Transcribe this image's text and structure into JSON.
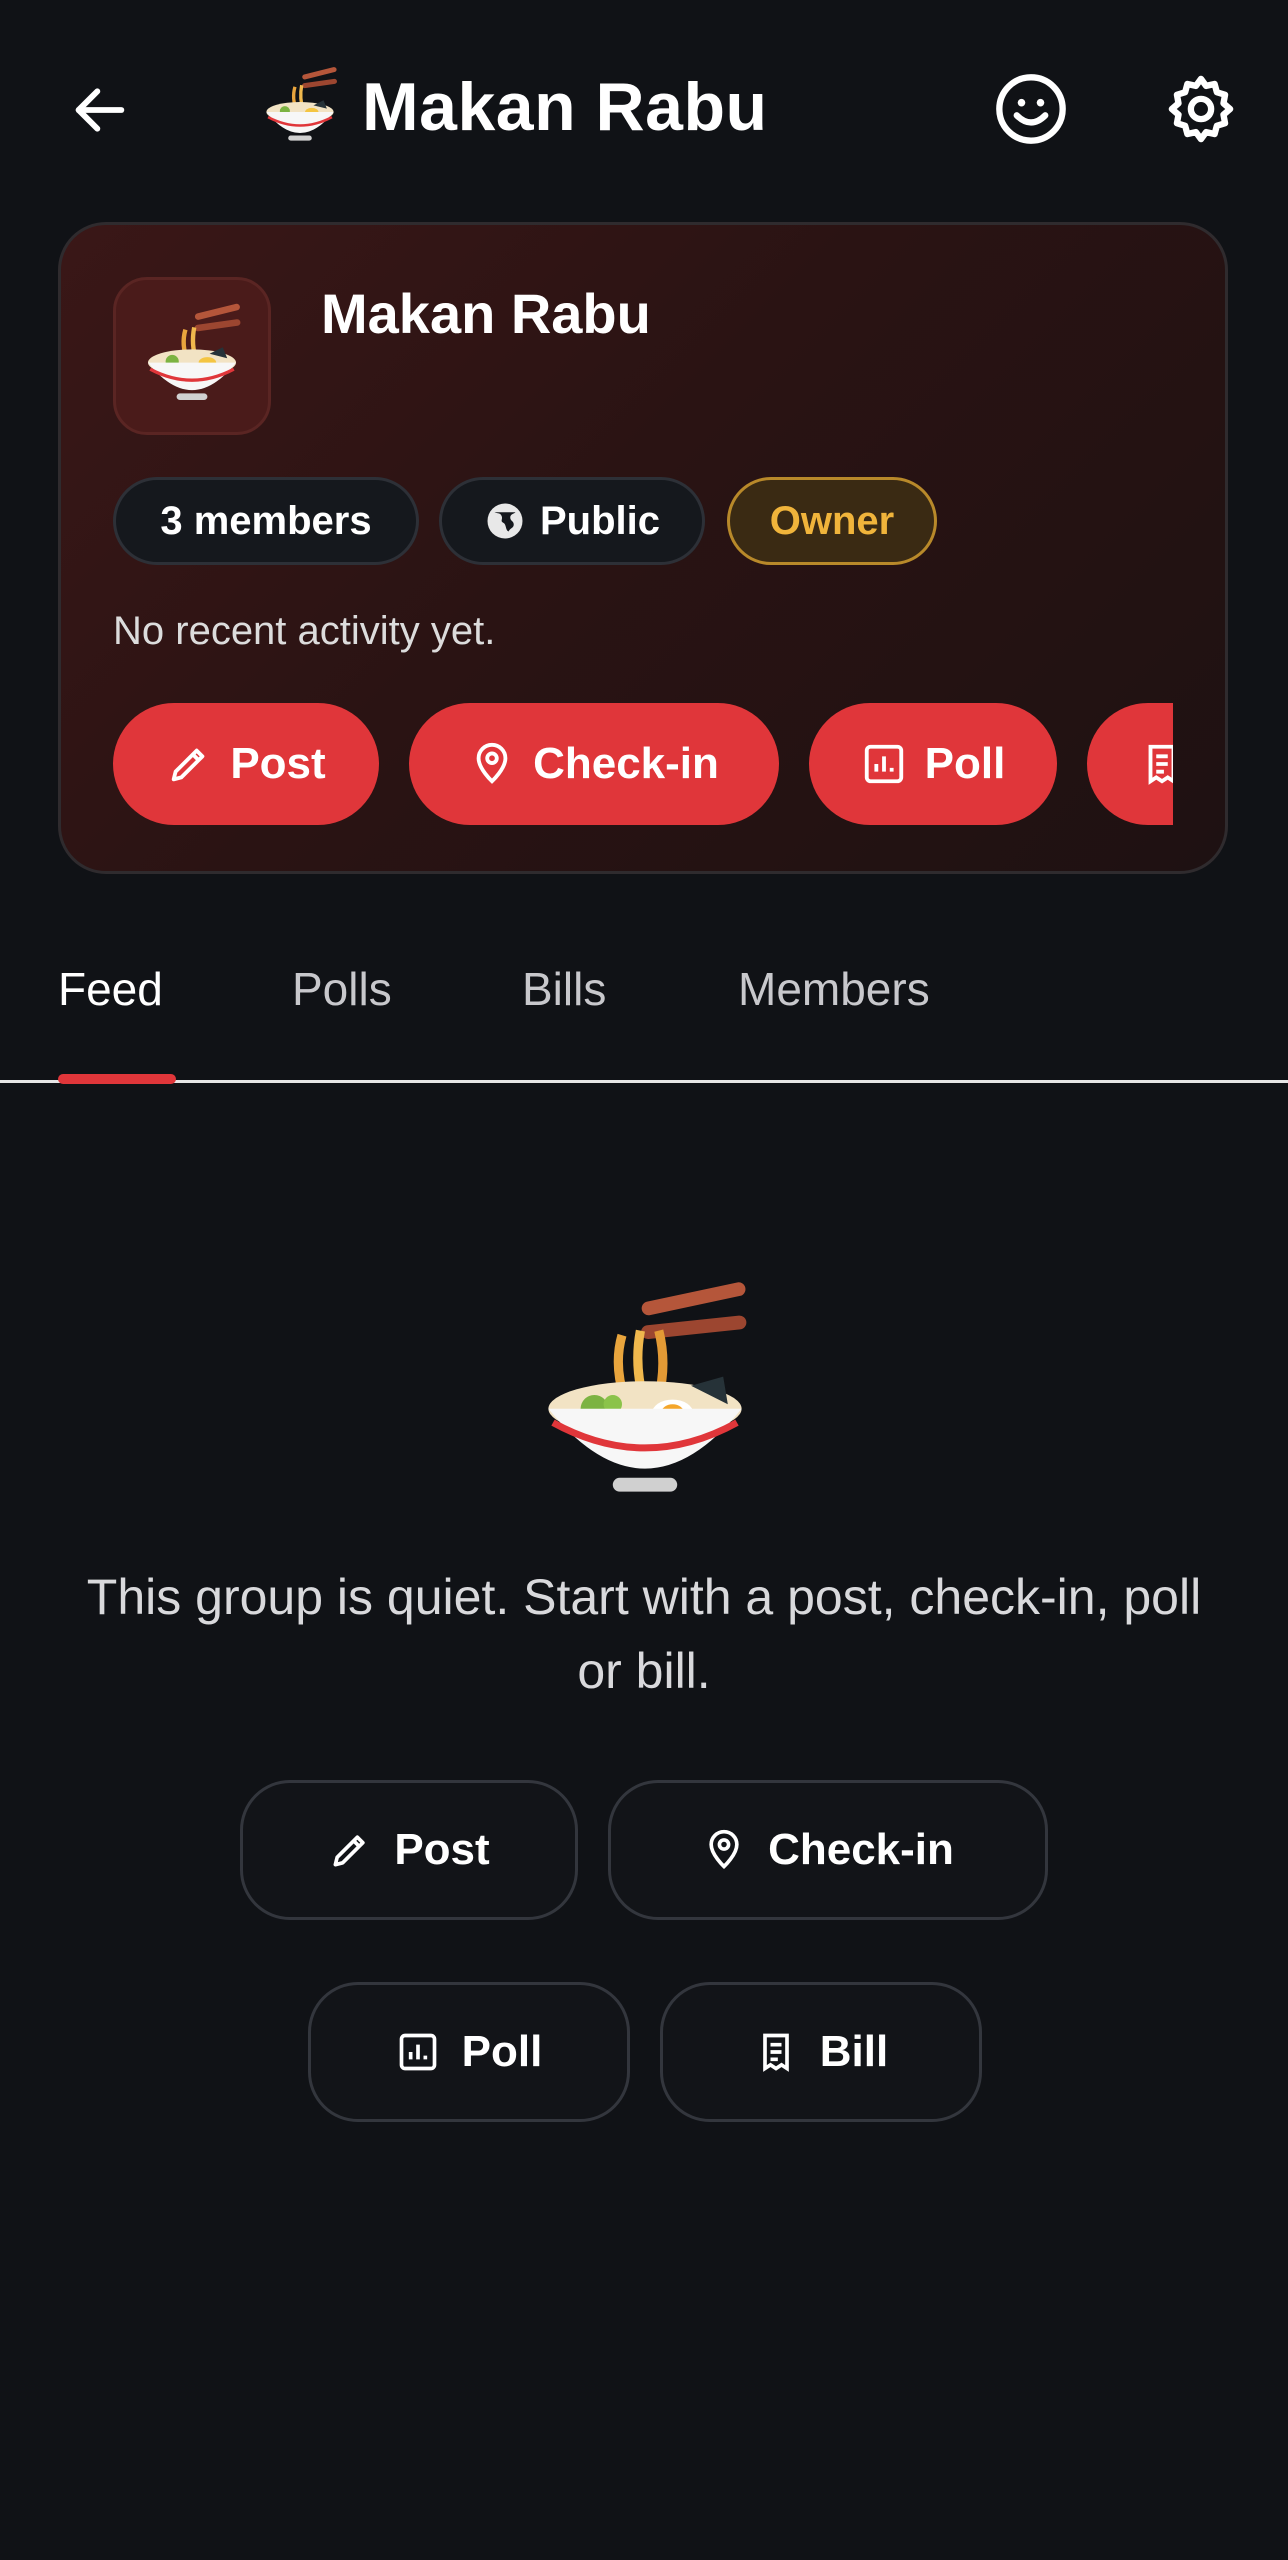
{
  "topbar": {
    "title": "Makan Rabu",
    "title_emoji": "ramen-bowl",
    "icons": [
      "back-arrow-icon",
      "smiley-icon",
      "gear-icon"
    ]
  },
  "card": {
    "name": "Makan Rabu",
    "chips": {
      "members": "3 members",
      "visibility": "Public",
      "role": "Owner"
    },
    "activity": "No recent activity yet.",
    "actions": {
      "post": "Post",
      "checkin": "Check-in",
      "poll": "Poll"
    },
    "accent": "#e0363a",
    "owner_color": "#f0b43b"
  },
  "tabs": {
    "feed": "Feed",
    "polls": "Polls",
    "bills": "Bills",
    "members": "Members",
    "active": "Feed"
  },
  "empty": {
    "message": "This group is quiet. Start with a post, check-in, poll or bill.",
    "buttons": {
      "post": "Post",
      "checkin": "Check-in",
      "poll": "Poll",
      "bill": "Bill"
    }
  },
  "colors": {
    "background": "#101216",
    "accent": "#e0363a"
  }
}
